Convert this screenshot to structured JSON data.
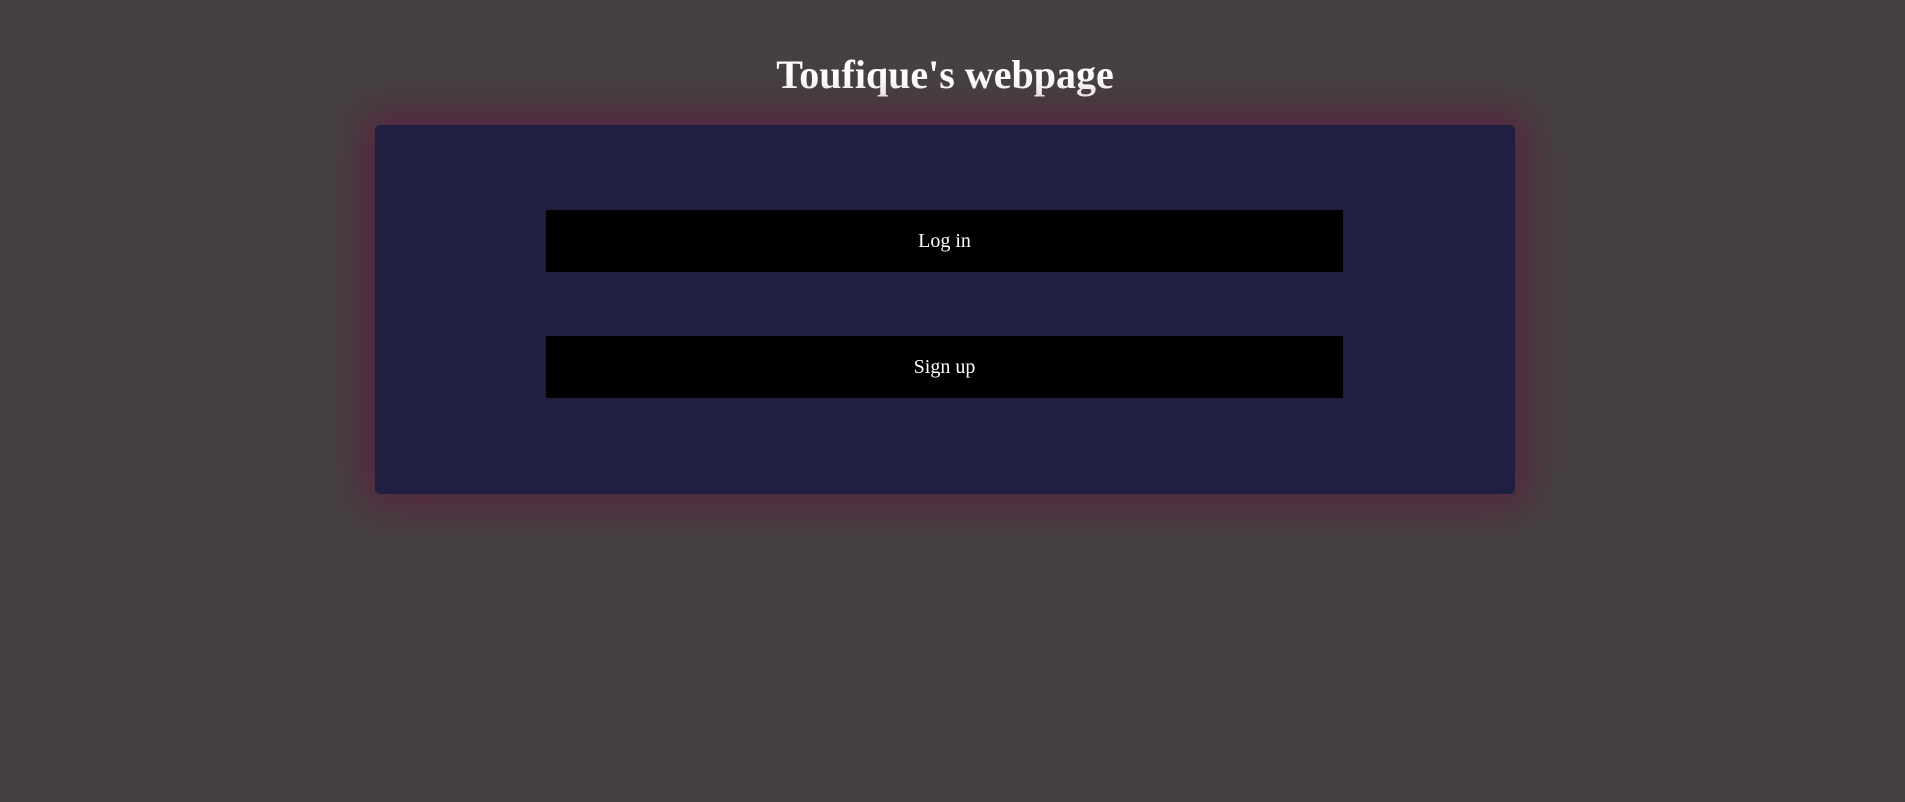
{
  "header": {
    "title": "Toufique's webpage"
  },
  "auth_card": {
    "login_label": "Log in",
    "signup_label": "Sign up"
  },
  "colors": {
    "background": "#464141",
    "card": "#211f41",
    "card_glow": "#5c1a42",
    "button": "#000000",
    "text": "#ffffff"
  }
}
